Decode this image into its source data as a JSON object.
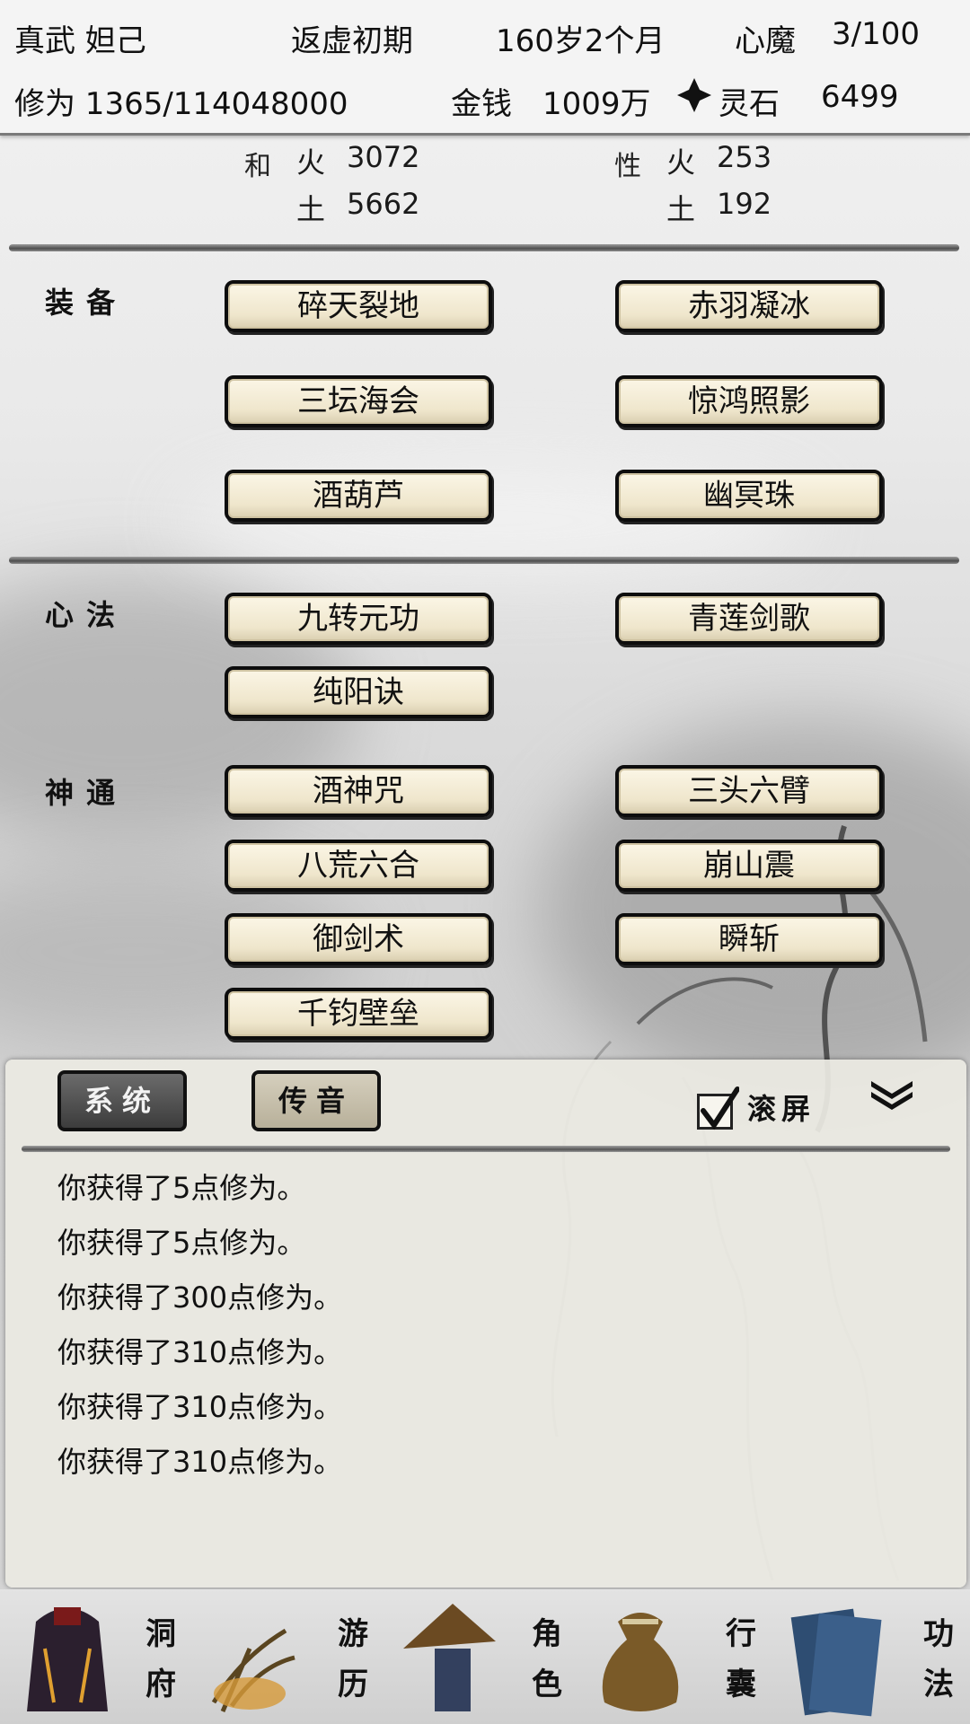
{
  "header": {
    "name": "真武 妲己",
    "realm": "返虚初期",
    "age": "160岁2个月",
    "demon_label": "心魔",
    "demon_value": "3/100",
    "cultivation": "修为 1365/114048000",
    "money_label": "金钱",
    "money_value": "1009万",
    "spirit_label": "灵石",
    "spirit_value": "6499"
  },
  "attributes": {
    "left_side_label": "和",
    "right_side_label": "性",
    "left": [
      {
        "element": "火",
        "value": "3072"
      },
      {
        "element": "土",
        "value": "5662"
      }
    ],
    "right": [
      {
        "element": "火",
        "value": "253"
      },
      {
        "element": "土",
        "value": "192"
      }
    ]
  },
  "sections": {
    "equipment": {
      "label": "装备",
      "items": [
        "碎天裂地",
        "赤羽凝冰",
        "三坛海会",
        "惊鸿照影",
        "酒葫芦",
        "幽冥珠"
      ]
    },
    "mind_method": {
      "label": "心法",
      "items": [
        "九转元功",
        "青莲剑歌",
        "纯阳诀"
      ]
    },
    "divine_power": {
      "label": "神通",
      "items": [
        "酒神咒",
        "三头六臂",
        "八荒六合",
        "崩山震",
        "御剑术",
        "瞬斩",
        "千钧壁垒"
      ]
    }
  },
  "chat": {
    "tabs": [
      "系统",
      "传音"
    ],
    "scroll_label": "滚屏",
    "scroll_checked": true,
    "messages": [
      "你获得了5点修为。",
      "你获得了5点修为。",
      "你获得了300点修为。",
      "你获得了310点修为。",
      "你获得了310点修为。",
      "你获得了310点修为。"
    ]
  },
  "nav": [
    {
      "top": "洞",
      "bottom": "府",
      "icon": "cave-icon"
    },
    {
      "top": "游",
      "bottom": "历",
      "icon": "travel-icon"
    },
    {
      "top": "角",
      "bottom": "色",
      "icon": "character-icon"
    },
    {
      "top": "行",
      "bottom": "囊",
      "icon": "bag-icon"
    },
    {
      "top": "功",
      "bottom": "法",
      "icon": "book-icon"
    }
  ],
  "colors": {
    "button_fill": "#efe6cc",
    "button_border": "#0d0d0d",
    "active_tab": "#4a4a4a",
    "inactive_tab": "#c6bfa9"
  }
}
